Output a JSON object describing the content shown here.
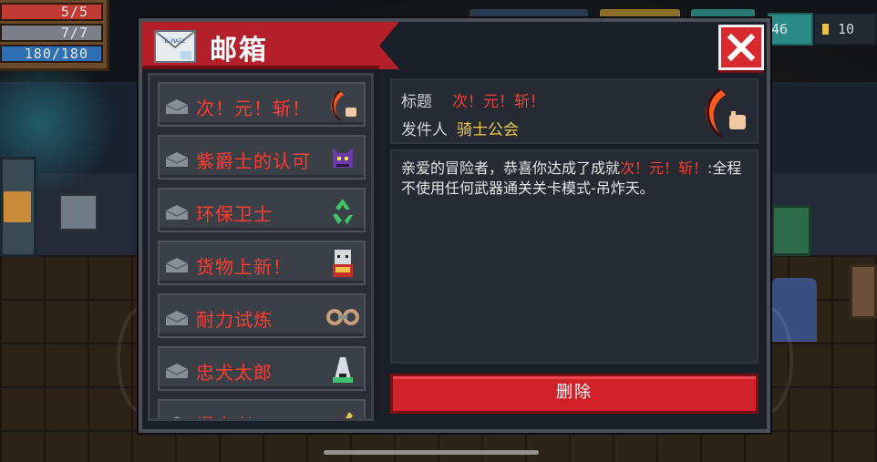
{
  "hud": {
    "hp": "5/5",
    "armor": "7/7",
    "energy": "180/180",
    "gems": "46",
    "coins": "10"
  },
  "mailbox": {
    "title": "邮箱",
    "mail_icon_text": "E-MAIL",
    "mails": [
      {
        "label": "次！元！斩！",
        "icon": "crescent-blade-icon"
      },
      {
        "label": "紫爵士的认可",
        "icon": "purple-knight-icon"
      },
      {
        "label": "环保卫士",
        "icon": "recycle-icon"
      },
      {
        "label": "货物上新！",
        "icon": "vending-cat-icon"
      },
      {
        "label": "耐力试炼",
        "icon": "dumbbell-icon"
      },
      {
        "label": "忠犬太郎",
        "icon": "dog-bowl-icon"
      },
      {
        "label": "爆金者",
        "icon": "gold-icon"
      }
    ],
    "detail": {
      "title_label": "标题",
      "title_value": "次！元！斩！",
      "sender_label": "发件人",
      "sender_value": "骑士公会",
      "body_prefix": "亲爱的冒险者，恭喜你达成了成就",
      "body_highlight": "次！元！斩！",
      "body_suffix": ":全程不使用任何武器通关关卡模式-吊炸天。"
    },
    "delete_label": "删除"
  },
  "colors": {
    "accent_red": "#d1222a",
    "text_red": "#ff3b30",
    "text_yellow": "#f2c94c"
  }
}
